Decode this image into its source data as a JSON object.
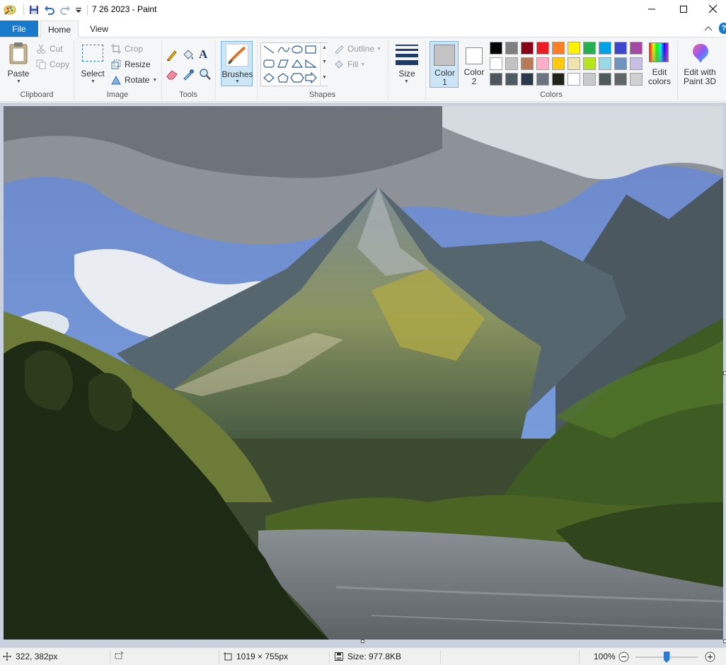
{
  "window": {
    "title": "7 26 2023 - Paint",
    "controls": [
      "minimize-icon",
      "maximize-icon",
      "close-icon"
    ]
  },
  "quick_access": [
    "paint-app-icon",
    "save-icon",
    "undo-icon",
    "redo-icon",
    "customize-icon"
  ],
  "tabs": {
    "file": "File",
    "home": "Home",
    "view": "View"
  },
  "ribbon": {
    "clipboard": {
      "paste": "Paste",
      "cut": "Cut",
      "copy": "Copy",
      "group": "Clipboard"
    },
    "image": {
      "select": "Select",
      "crop": "Crop",
      "resize": "Resize",
      "rotate": "Rotate",
      "group": "Image"
    },
    "tools": {
      "group": "Tools"
    },
    "brushes": {
      "label": "Brushes"
    },
    "shapes": {
      "outline": "Outline",
      "fill": "Fill",
      "group": "Shapes"
    },
    "size": {
      "label": "Size"
    },
    "colors": {
      "color1_line1": "Color",
      "color1_line2": "1",
      "color2_line1": "Color",
      "color2_line2": "2",
      "color1_value": "#c3c3c3",
      "color2_value": "#ffffff",
      "palette_row1": [
        "#000000",
        "#7f7f7f",
        "#880015",
        "#ed1c24",
        "#ff7f27",
        "#fff200",
        "#22b14c",
        "#00a2e8",
        "#3f48cc",
        "#a349a4"
      ],
      "palette_row2": [
        "#ffffff",
        "#c3c3c3",
        "#b97a57",
        "#ffaec9",
        "#ffc90e",
        "#efe4b0",
        "#b5e61d",
        "#99d9ea",
        "#7092be",
        "#c8bfe7"
      ],
      "palette_row3": [
        "#4d565e",
        "#4e5a63",
        "#2b3a4a",
        "#6b7580",
        "#1f2418",
        "#ffffff",
        "#c6cbc9",
        "#4f5a5a",
        "#5e6764",
        "#d0d0d0"
      ],
      "edit_colors_line1": "Edit",
      "edit_colors_line2": "colors",
      "group": "Colors"
    },
    "paint3d": {
      "line1": "Edit with",
      "line2": "Paint 3D"
    }
  },
  "status": {
    "cursor_position": "322, 382px",
    "image_dimensions": "1019 × 755px",
    "file_size": "Size: 977.8KB",
    "zoom": "100%",
    "zoom_slider_fraction": 0.5
  },
  "accent_color": "#1979ca"
}
